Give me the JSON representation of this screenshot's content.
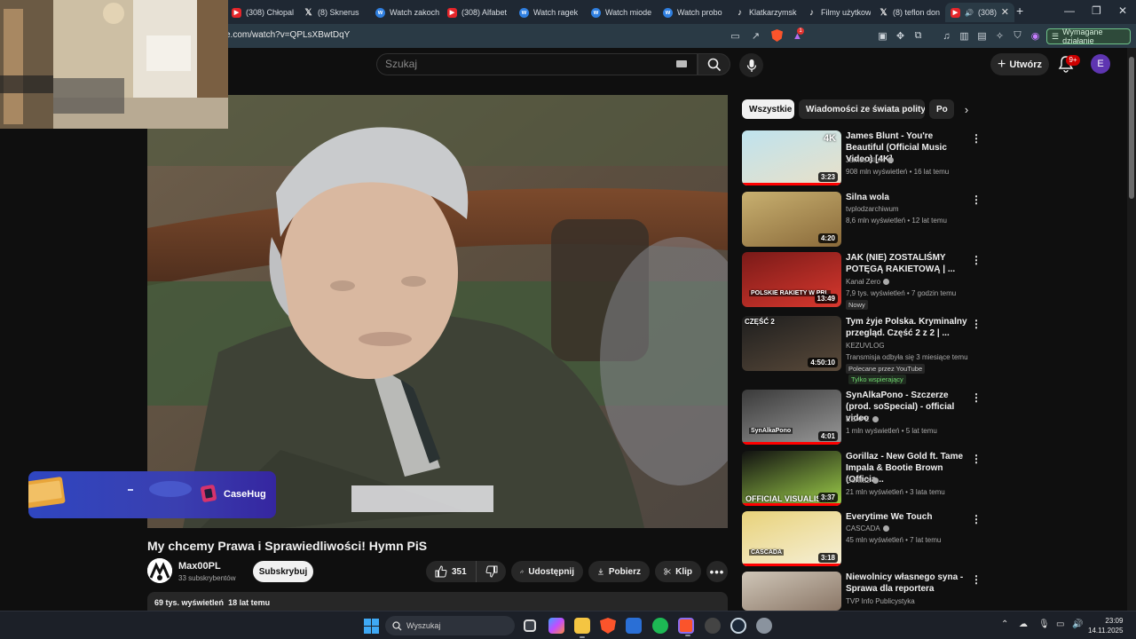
{
  "browser": {
    "tabs": [
      {
        "label": "(308) Chłopal",
        "fav": "yt"
      },
      {
        "label": "(8) Sknerus",
        "fav": "x"
      },
      {
        "label": "Watch zakoch",
        "fav": "ww"
      },
      {
        "label": "(308) Alfabet",
        "fav": "yt"
      },
      {
        "label": "Watch ragek",
        "fav": "ww"
      },
      {
        "label": "Watch miode",
        "fav": "ww"
      },
      {
        "label": "Watch probo",
        "fav": "ww"
      },
      {
        "label": "Klatkarzymsk",
        "fav": "tt"
      },
      {
        "label": "Filmy użytkow",
        "fav": "tt"
      },
      {
        "label": "(8) teflon don",
        "fav": "x"
      },
      {
        "label": "(308)",
        "fav": "yt"
      }
    ],
    "active_tab_index": 10,
    "url": "e.com/watch?v=QPLsXBwtDqY",
    "brave_badge": "1",
    "required_action_label": "Wymagane działanie",
    "accent_color": "#6fc389"
  },
  "youtube": {
    "search_placeholder": "Szukaj",
    "create_label": "Utwórz",
    "notifications_count": "9+",
    "avatar_letter": "E",
    "video": {
      "title": "My chcemy Prawa i Sprawiedliwości! Hymn PiS",
      "channel": "Max00PL",
      "subscribers": "33 subskrybentów",
      "subscribe_label": "Subskrybuj",
      "likes": "351",
      "share_label": "Udostępnij",
      "download_label": "Pobierz",
      "clip_label": "Klip",
      "views": "69 tys. wyświetleń",
      "uploaded": "18 lat temu"
    },
    "overlay": {
      "sponsor_label": "CaseHug"
    },
    "chips": [
      "Wszystkie",
      "Wiadomości ze świata polityki",
      "Po"
    ],
    "recommendations": [
      {
        "title": "James Blunt - You're Beautiful (Official Music Video) [4K]",
        "channel": "James Blunt",
        "verified": true,
        "views": "908 mln wyświetleń",
        "age": "16 lat temu",
        "duration": "3:23",
        "thumb_tag": "4K",
        "badges": [],
        "progress_fraction": 1.0
      },
      {
        "title": "Silna wola",
        "channel": "tvplodzarchiwum",
        "verified": false,
        "views": "8,6 mln wyświetleń",
        "age": "12 lat temu",
        "duration": "4:20",
        "thumb_tag": "",
        "badges": [],
        "progress_fraction": 0
      },
      {
        "title": "JAK (NIE) ZOSTALIŚMY POTĘGĄ RAKIETOWĄ | ...",
        "channel": "Kanał Zero",
        "verified": true,
        "views": "7,9 tys. wyświetleń",
        "age": "7 godzin temu",
        "duration": "13:49",
        "thumb_tag": "POLSKIE RAKIETY W PRL",
        "badges": [
          "Nowy"
        ],
        "progress_fraction": 0
      },
      {
        "title": "Tym żyje Polska. Kryminalny przegląd. Część 2 z 2 | ...",
        "channel": "KEZUVLOG",
        "verified": false,
        "views": "Transmisja odbyła się 3 miesiące temu",
        "age": "",
        "duration": "4:50:10",
        "thumb_tag": "CZĘŚĆ 2",
        "badges": [
          "Polecane przez YouTube",
          "Tylko wspierający"
        ],
        "progress_fraction": 0
      },
      {
        "title": "SynAlkaPono - Szczerze (prod. soSpecial) - official video",
        "channel": "ESAPE",
        "verified": true,
        "views": "1 mln wyświetleń",
        "age": "5 lat temu",
        "duration": "4:01",
        "thumb_tag": "SynAlkaPono",
        "badges": [],
        "progress_fraction": 1.0
      },
      {
        "title": "Gorillaz - New Gold ft. Tame Impala & Bootie Brown (Officia...",
        "channel": "Gorillaz",
        "verified": true,
        "views": "21 mln wyświetleń",
        "age": "3 lata temu",
        "duration": "3:37",
        "thumb_tag": "OFFICIAL VISUALISER",
        "badges": [],
        "progress_fraction": 1.0
      },
      {
        "title": "Everytime We Touch",
        "channel": "CASCADA",
        "verified": true,
        "views": "45 mln wyświetleń",
        "age": "7 lat temu",
        "duration": "3:18",
        "thumb_tag": "CASCADA",
        "badges": [],
        "progress_fraction": 1.0
      },
      {
        "title": "Niewolnicy własnego syna - Sprawa dla reportera",
        "channel": "TVP Info Publicystyka",
        "verified": false,
        "views": "",
        "age": "",
        "duration": "",
        "thumb_tag": "",
        "badges": [],
        "progress_fraction": 0
      }
    ]
  },
  "taskbar": {
    "search_placeholder": "Wyszukaj",
    "time": "23:09",
    "date": "14.11.2025"
  }
}
